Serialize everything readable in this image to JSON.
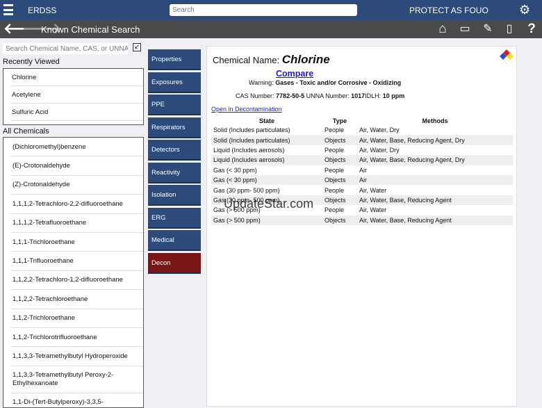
{
  "header": {
    "app_name": "ERDSS",
    "search_placeholder": "Search",
    "classification": "PROTECT AS FOUO"
  },
  "subheader": {
    "title": "Known Chemical Search",
    "icons": [
      "home-icon",
      "save-icon",
      "notes-icon",
      "document-icon",
      "help-icon"
    ]
  },
  "sidebar": {
    "search_placeholder": "Search Chemical Name, CAS, or UNNA",
    "recent_label": "Recently Viewed",
    "recent": [
      "Chlorine",
      "Acetylene",
      "Sulfuric Acid"
    ],
    "all_label": "All Chemicals",
    "all": [
      "(Dichloromethyl)benzene",
      "(E)-Crotonaldehyde",
      "(Z)-Crotonaldehyde",
      "1,1,1,2-Tetrachloro-2,2-difluoroethane",
      "1,1,1,2-Tetrafluoroethane",
      "1,1,1-Trichloroethane",
      "1,1,1-Trifluoroethane",
      "1,1,2,2-Tetrachloro-1,2-difluoroethane",
      "1,1,2,2-Tetrachloroethane",
      "1,1,2-Trichloroethane",
      "1,1,2-Trichlorotrifluoroethane",
      "1,1,3,3-Tetramethylbutyl Hydroperoxide",
      "1,1,3,3-Tetramethylbutyl Peroxy-2-Ethylhexanoate",
      "1,1-Di-(Tert-Butylperoxy)-3,3,5-"
    ]
  },
  "nav": [
    "Properties",
    "Exposures",
    "PPE",
    "Respirators",
    "Detectors",
    "Reactivity",
    "Isolation",
    "ERG",
    "Medical",
    "Decon"
  ],
  "active_nav": "Decon",
  "detail": {
    "name_label": "Chemical Name:",
    "name": "Chlorine",
    "compare": "Compare",
    "warning_label": "Warning:",
    "warning": "Gases - Toxic and/or Corrosive - Oxidizing",
    "cas_label": "CAS Number:",
    "cas": "7782-50-5",
    "unna_label": "UNNA Number:",
    "unna": "1017",
    "idlh_label": "IDLH:",
    "idlh": "10 ppm",
    "decon_link": "Open in Decontamination",
    "columns": [
      "State",
      "Type",
      "Methods"
    ],
    "rows": [
      [
        "Solid (Includes particulates)",
        "People",
        "Air, Water, Dry"
      ],
      [
        "Solid (Includes particulates)",
        "Objects",
        "Air, Water, Base, Reducing Agent, Dry"
      ],
      [
        "Liquid (Includes aerosols)",
        "People",
        "Air, Water, Dry"
      ],
      [
        "Liquid (Includes aerosols)",
        "Objects",
        "Air, Water, Base, Reducing Agent, Dry"
      ],
      [
        "Gas (< 30 ppm)",
        "People",
        "Air"
      ],
      [
        "Gas (< 30 ppm)",
        "Objects",
        "Air"
      ],
      [
        "Gas (30 ppm- 500 ppm)",
        "People",
        "Air, Water"
      ],
      [
        "Gas (30 ppm- 500 ppm)",
        "Objects",
        "Air, Water, Base, Reducing Agent"
      ],
      [
        "Gas (> 500 ppm)",
        "People",
        "Air, Water"
      ],
      [
        "Gas (> 500 ppm)",
        "Objects",
        "Air, Water, Base, Reducing Agent"
      ]
    ]
  },
  "watermark": "UpdateStar.com",
  "colors": {
    "header": "#2c4a7a",
    "subheader": "#4a4a4c",
    "active_nav": "#7a1515",
    "link": "#1a1adb"
  }
}
